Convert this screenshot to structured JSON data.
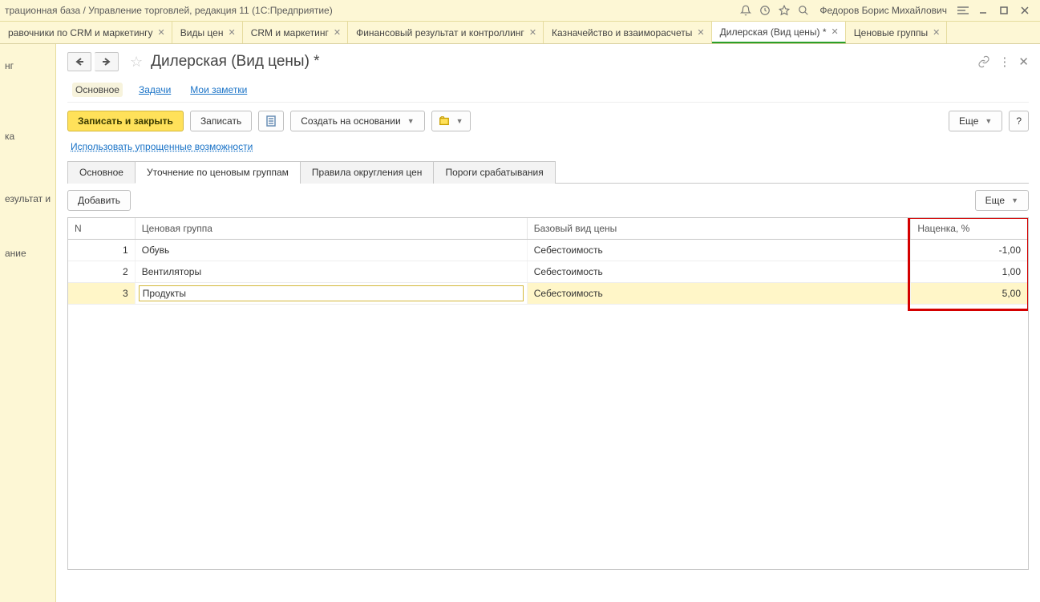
{
  "titlebar": {
    "title": "трационная база / Управление торговлей, редакция 11  (1С:Предприятие)",
    "user": "Федоров Борис Михайлович"
  },
  "tabs": [
    {
      "label": "равочники по CRM и маркетингу",
      "closable": true
    },
    {
      "label": "Виды цен",
      "closable": true
    },
    {
      "label": "CRM и маркетинг",
      "closable": true
    },
    {
      "label": "Финансовый результат и контроллинг",
      "closable": true
    },
    {
      "label": "Казначейство и взаиморасчеты",
      "closable": true
    },
    {
      "label": "Дилерская (Вид цены) *",
      "closable": true,
      "active": true
    },
    {
      "label": "Ценовые группы",
      "closable": true
    }
  ],
  "sidebar": {
    "items": [
      "нг",
      "ка",
      "езультат и",
      "ание"
    ]
  },
  "page": {
    "title": "Дилерская (Вид цены) *"
  },
  "section_tabs": {
    "main": "Основное",
    "tasks": "Задачи",
    "notes": "Мои заметки"
  },
  "toolbar": {
    "save_close": "Записать и закрыть",
    "save": "Записать",
    "create_based": "Создать на основании",
    "more": "Еще",
    "help": "?"
  },
  "link_simplified": "Использовать упрощенные возможности",
  "form_tabs": [
    {
      "label": "Основное"
    },
    {
      "label": "Уточнение по ценовым группам",
      "active": true
    },
    {
      "label": "Правила округления цен"
    },
    {
      "label": "Пороги срабатывания"
    }
  ],
  "grid_toolbar": {
    "add": "Добавить",
    "more": "Еще"
  },
  "grid": {
    "headers": {
      "n": "N",
      "group": "Ценовая группа",
      "base": "Базовый вид цены",
      "markup": "Наценка, %"
    },
    "rows": [
      {
        "n": "1",
        "group": "Обувь",
        "base": "Себестоимость",
        "markup": "-1,00"
      },
      {
        "n": "2",
        "group": "Вентиляторы",
        "base": "Себестоимость",
        "markup": "1,00"
      },
      {
        "n": "3",
        "group": "Продукты",
        "base": "Себестоимость",
        "markup": "5,00",
        "selected": true
      }
    ]
  }
}
